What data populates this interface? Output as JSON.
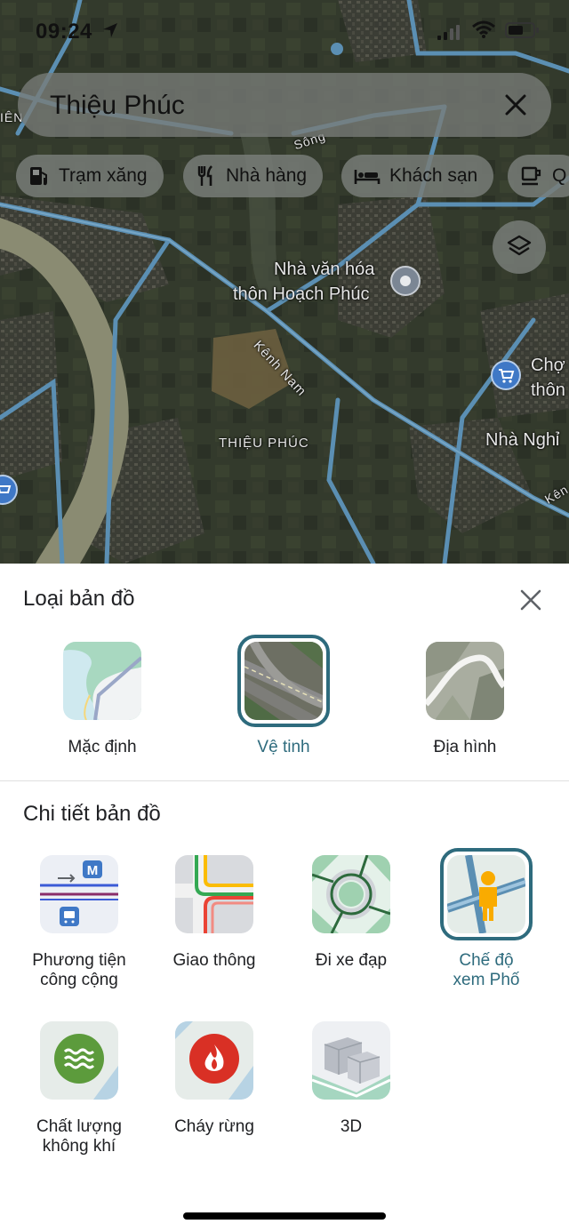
{
  "status_bar": {
    "time": "09:24"
  },
  "search": {
    "query": "Thiệu Phúc"
  },
  "chips": [
    {
      "label": "Trạm xăng",
      "icon": "gas-station-icon"
    },
    {
      "label": "Nhà hàng",
      "icon": "restaurant-icon"
    },
    {
      "label": "Khách sạn",
      "icon": "hotel-icon"
    },
    {
      "label": "Q",
      "icon": "coffee-icon"
    }
  ],
  "map": {
    "labels": {
      "poi_culture_line1": "Nhà văn hóa",
      "poi_culture_line2": "thôn Hoạch Phúc",
      "canal": "Kênh Nam",
      "area": "THIỆU PHÚC",
      "market_line1": "Chợ",
      "market_line2": "thôn",
      "guesthouse": "Nhà Nghỉ",
      "river": "Sông",
      "left_edge": "IÊN",
      "right_edge": "Kên"
    }
  },
  "sheet": {
    "map_type_title": "Loại bản đồ",
    "map_types": [
      {
        "label": "Mặc định",
        "selected": false
      },
      {
        "label": "Vệ tinh",
        "selected": true
      },
      {
        "label": "Địa hình",
        "selected": false
      }
    ],
    "details_title": "Chi tiết bản đồ",
    "details": [
      {
        "label_line1": "Phương tiện",
        "label_line2": "công cộng",
        "selected": false
      },
      {
        "label_line1": "Giao thông",
        "label_line2": "",
        "selected": false
      },
      {
        "label_line1": "Đi xe đạp",
        "label_line2": "",
        "selected": false
      },
      {
        "label_line1": "Chế độ",
        "label_line2": "xem Phố",
        "selected": true
      },
      {
        "label_line1": "Chất lượng",
        "label_line2": "không khí",
        "selected": false
      },
      {
        "label_line1": "Cháy rừng",
        "label_line2": "",
        "selected": false
      },
      {
        "label_line1": "3D",
        "label_line2": "",
        "selected": false
      }
    ]
  },
  "colors": {
    "accent": "#2e6b7d",
    "road": "#5b8fb3",
    "satellite_bg": "#2f3529"
  }
}
